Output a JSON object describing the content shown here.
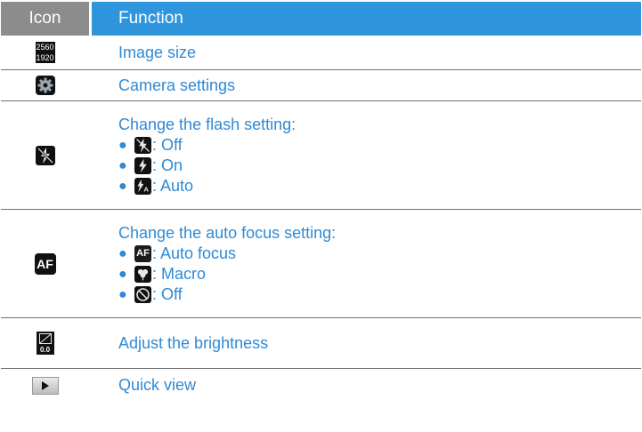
{
  "header": {
    "icon_col": "Icon",
    "function_col": "Function"
  },
  "rows": [
    {
      "icon": "image-size-icon",
      "icon_text": [
        "2560",
        "1920"
      ],
      "function": "Image size"
    },
    {
      "icon": "camera-settings-gear-icon",
      "function": "Camera settings"
    },
    {
      "icon": "flash-off-icon",
      "function": "Change the flash setting:",
      "options": [
        {
          "icon": "flash-off-icon",
          "label": ": Off"
        },
        {
          "icon": "flash-on-icon",
          "label": ": On"
        },
        {
          "icon": "flash-auto-icon",
          "label": ": Auto"
        }
      ]
    },
    {
      "icon": "auto-focus-icon",
      "icon_text": "AF",
      "function": "Change the auto focus setting:",
      "options": [
        {
          "icon": "auto-focus-icon",
          "icon_text": "AF",
          "label": ": Auto focus"
        },
        {
          "icon": "macro-icon",
          "label": ": Macro"
        },
        {
          "icon": "focus-off-icon",
          "label": ": Off"
        }
      ]
    },
    {
      "icon": "brightness-icon",
      "icon_text": "0.0",
      "function": "Adjust the brightness"
    },
    {
      "icon": "play-icon",
      "function": "Quick view"
    }
  ],
  "colors": {
    "header_icon_bg": "#8c8c8c",
    "header_function_bg": "#2f95dd",
    "text_blue": "#2e8ad6"
  }
}
